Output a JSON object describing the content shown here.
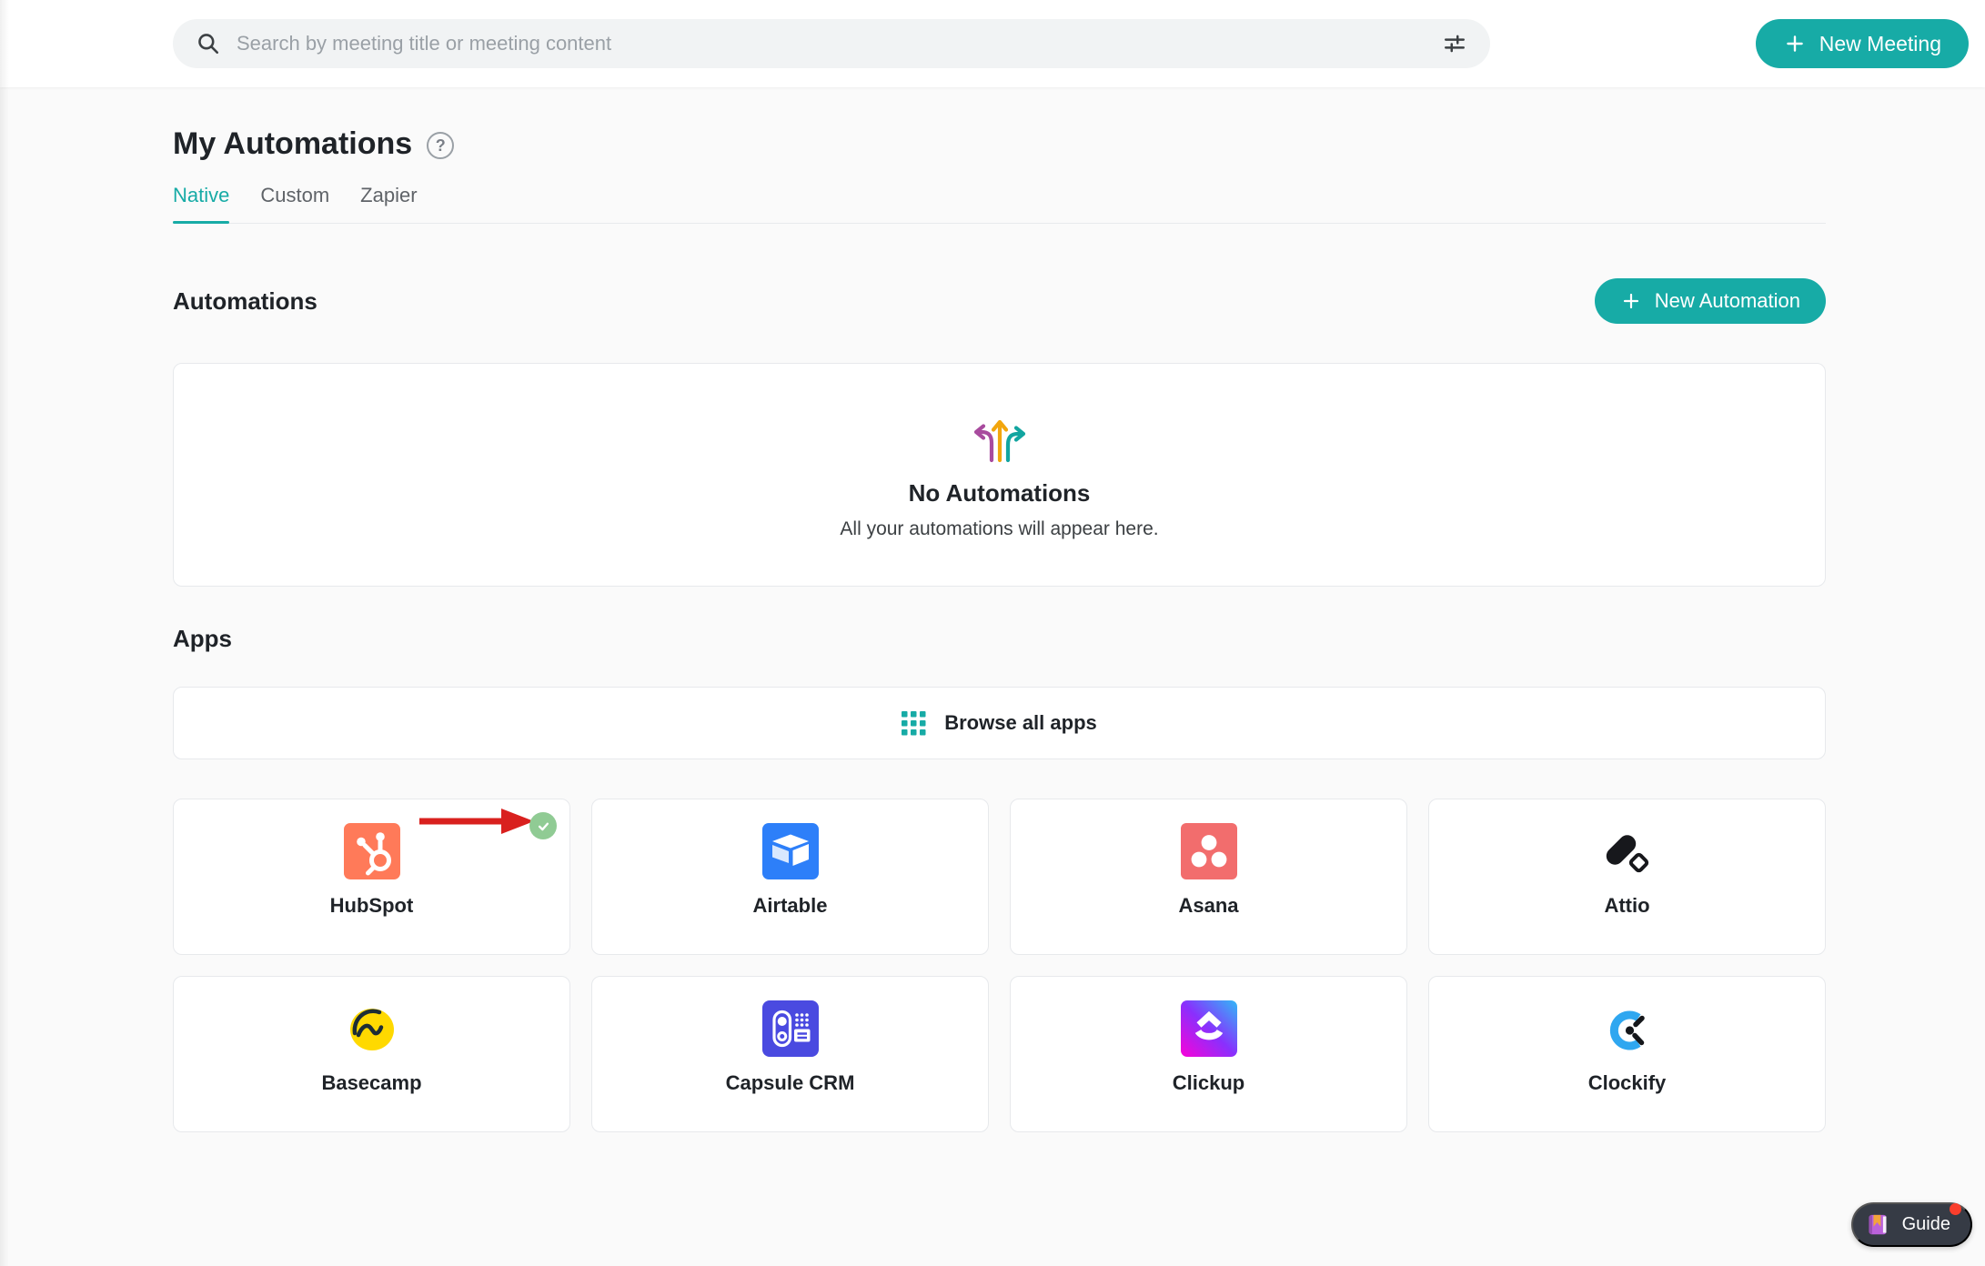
{
  "topbar": {
    "search": {
      "icon": "search-icon",
      "placeholder": "Search by meeting title or meeting content",
      "filter_icon": "filter-sliders-icon"
    },
    "new_meeting": {
      "label": "New Meeting",
      "icon": "plus-icon"
    }
  },
  "page": {
    "title": "My Automations",
    "help_icon": "help-circle-icon",
    "help_glyph": "?",
    "tabs": [
      {
        "label": "Native",
        "active": true
      },
      {
        "label": "Custom",
        "active": false
      },
      {
        "label": "Zapier",
        "active": false
      }
    ]
  },
  "automations_section": {
    "heading": "Automations",
    "new_automation": {
      "label": "New Automation",
      "icon": "plus-icon"
    },
    "empty_state": {
      "icon": "branching-arrows-icon",
      "title": "No Automations",
      "subtitle": "All your automations will appear here."
    }
  },
  "apps_section": {
    "heading": "Apps",
    "browse": {
      "icon": "grid-icon",
      "label": "Browse all apps"
    },
    "apps": [
      {
        "name": "HubSpot",
        "icon": "hubspot-icon",
        "brand_color": "#FF7A59",
        "connected": true
      },
      {
        "name": "Airtable",
        "icon": "airtable-icon",
        "brand_color": "#2D7FF9",
        "connected": false
      },
      {
        "name": "Asana",
        "icon": "asana-icon",
        "brand_color": "#F26D6D",
        "connected": false
      },
      {
        "name": "Attio",
        "icon": "attio-icon",
        "brand_color": "#17181C",
        "connected": false
      },
      {
        "name": "Basecamp",
        "icon": "basecamp-icon",
        "brand_color": "#FFD900",
        "connected": false
      },
      {
        "name": "Capsule CRM",
        "icon": "capsule-crm-icon",
        "brand_color": "#4A4AE0",
        "connected": false
      },
      {
        "name": "Clickup",
        "icon": "clickup-icon",
        "brand_color": "#8930FD",
        "connected": false
      },
      {
        "name": "Clockify",
        "icon": "clockify-icon",
        "brand_color": "#2FA7F0",
        "connected": false
      }
    ],
    "annotation": {
      "arrow_icon": "red-arrow-annotation",
      "check_icon": "connected-check-icon",
      "arrow_color": "#D9201E",
      "check_color": "#90CB94"
    }
  },
  "guide_button": {
    "label": "Guide",
    "icon": "book-icon",
    "has_notification": true
  },
  "colors": {
    "accent": "#17ABA6",
    "page_bg": "#FAFAFA",
    "topbar_bg": "#FFFFFF",
    "search_bg": "#F1F3F4",
    "card_border": "#E7E9EC"
  }
}
